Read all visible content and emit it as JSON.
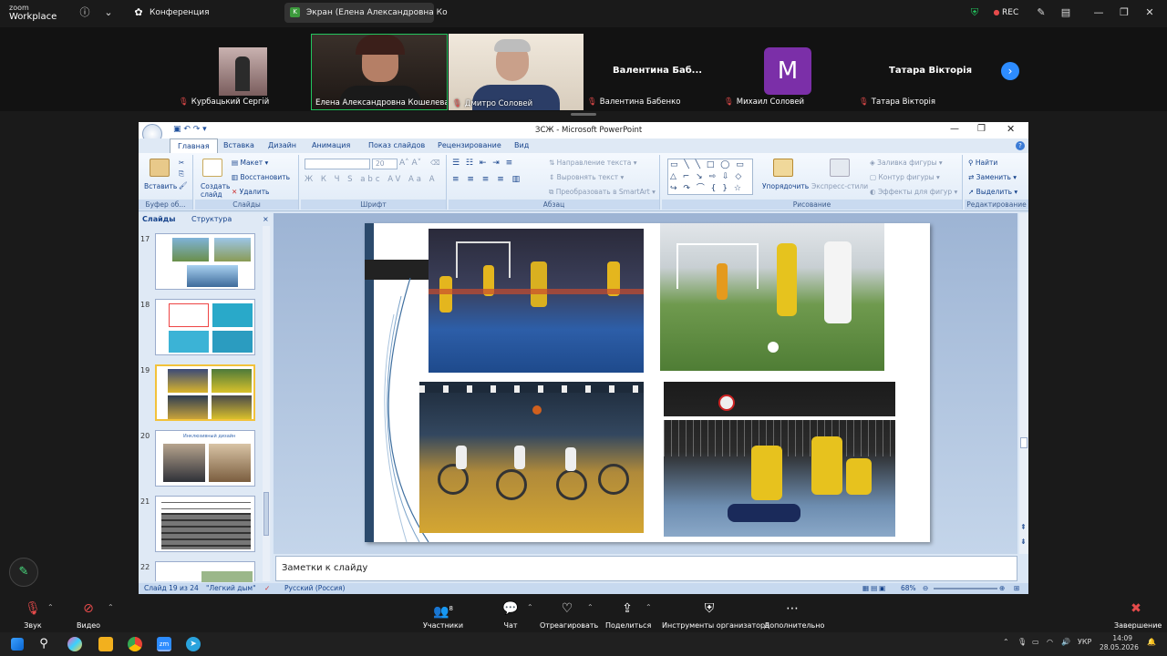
{
  "zoom": {
    "brand": "zoom",
    "product": "Workplace",
    "meeting_tab": "Конференция",
    "share_tab": "Экран (Елена Александровна Ко",
    "rec": "REC"
  },
  "participants": [
    {
      "name": "Курбацький Сергій"
    },
    {
      "name": "Елена Александровна Кошелева"
    },
    {
      "name": "Дмитро Соловей"
    },
    {
      "name": "Валентина Бабенко",
      "display": "Валентина  Баб..."
    },
    {
      "name": "Михаил Соловей",
      "avatar": "M"
    },
    {
      "name": "Татара Вікторія",
      "display": "Татара Вікторія"
    }
  ],
  "powerpoint": {
    "title": "ЗСЖ - Microsoft PowerPoint",
    "tabs": [
      "Главная",
      "Вставка",
      "Дизайн",
      "Анимация",
      "Показ слайдов",
      "Рецензирование",
      "Вид"
    ],
    "ribbon": {
      "paste": "Вставить",
      "clipboard": "Буфер об...",
      "create_slide": "Создать слайд",
      "layout": "Макет",
      "reset": "Восстановить",
      "delete": "Удалить",
      "slides_group": "Слайды",
      "font_size": "20",
      "font_group": "Шрифт",
      "text_direction": "Направление текста",
      "align_text": "Выровнять текст",
      "smartart": "Преобразовать в SmartArt",
      "paragraph_group": "Абзац",
      "arrange": "Упорядочить",
      "quick_styles": "Экспресс-стили",
      "shape_fill": "Заливка фигуры",
      "shape_outline": "Контур фигуры",
      "shape_effects": "Эффекты для фигур",
      "drawing_group": "Рисование",
      "find": "Найти",
      "replace": "Заменить",
      "select": "Выделить",
      "editing_group": "Редактирование"
    },
    "pane_tabs": [
      "Слайды",
      "Структура"
    ],
    "thumbnails": [
      "17",
      "18",
      "19",
      "20",
      "21",
      "22"
    ],
    "thumb20_caption": "Инклюзивный дизайн",
    "notes_placeholder": "Заметки к слайду",
    "status": {
      "slide": "Слайд 19 из 24",
      "theme": "\"Легкий дым\"",
      "language": "Русский (Россия)",
      "zoom": "68%"
    }
  },
  "toolbar": {
    "audio": "Звук",
    "video": "Видео",
    "participants": "Участники",
    "participants_count": "8",
    "chat": "Чат",
    "react": "Отреагировать",
    "share": "Поделиться",
    "host_tools": "Инструменты организатора",
    "more": "Дополнительно",
    "end": "Завершение"
  },
  "taskbar": {
    "lang": "УКР",
    "time": "14:09",
    "date": "28.05.2026"
  },
  "colors": {
    "zoom_blue": "#2d8cff",
    "ppt_ribbon": "#dfeaf7",
    "selected_thumb": "#f2c23a",
    "muted_red": "#e64b4b"
  }
}
